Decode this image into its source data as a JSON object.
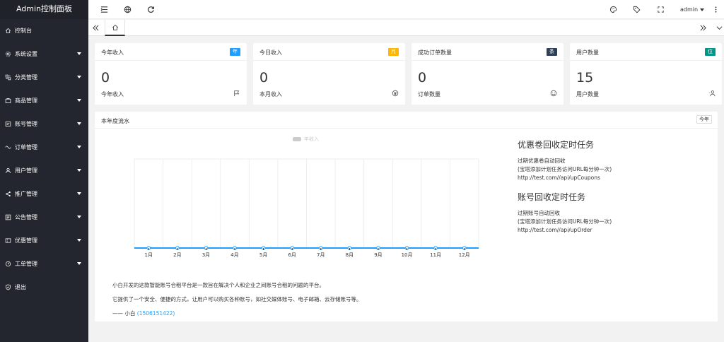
{
  "app": {
    "title": "Admin控制面板"
  },
  "sidebar": {
    "items": [
      {
        "label": "控制台",
        "icon": "home-icon",
        "arrow": false
      },
      {
        "label": "系统设置",
        "icon": "gear-icon",
        "arrow": true
      },
      {
        "label": "分类管理",
        "icon": "category-icon",
        "arrow": true
      },
      {
        "label": "商品管理",
        "icon": "product-icon",
        "arrow": true
      },
      {
        "label": "账号管理",
        "icon": "account-icon",
        "arrow": true
      },
      {
        "label": "订单管理",
        "icon": "order-icon",
        "arrow": true
      },
      {
        "label": "用户管理",
        "icon": "user-icon",
        "arrow": true
      },
      {
        "label": "推广管理",
        "icon": "share-icon",
        "arrow": true
      },
      {
        "label": "公告管理",
        "icon": "notice-icon",
        "arrow": true
      },
      {
        "label": "优惠管理",
        "icon": "coupon-icon",
        "arrow": true
      },
      {
        "label": "工单管理",
        "icon": "clock-icon",
        "arrow": true
      },
      {
        "label": "退出",
        "icon": "shield-icon",
        "arrow": false
      }
    ]
  },
  "topbar": {
    "user": "admin"
  },
  "cards": [
    {
      "title": "今年收入",
      "badge": "年",
      "badge_color": "#1e9fff",
      "value": "0",
      "sub": "今年收入",
      "icon": "flag-icon"
    },
    {
      "title": "今日收入",
      "badge": "月",
      "badge_color": "#ffb800",
      "value": "0",
      "sub": "本月收入",
      "icon": "money-icon"
    },
    {
      "title": "成功订单数量",
      "badge": "条",
      "badge_color": "#2f4056",
      "value": "0",
      "sub": "订单数量",
      "icon": "smile-icon"
    },
    {
      "title": "用户数量",
      "badge": "位",
      "badge_color": "#009688",
      "value": "15",
      "sub": "用户数量",
      "icon": "users-icon"
    }
  ],
  "panel": {
    "title": "本年度流水",
    "badge": "今年"
  },
  "chart_data": {
    "type": "line",
    "categories": [
      "1月",
      "2月",
      "3月",
      "4月",
      "5月",
      "6月",
      "7月",
      "8月",
      "9月",
      "10月",
      "11月",
      "12月"
    ],
    "series": [
      {
        "name": "年收入",
        "values": [
          0,
          0,
          0,
          0,
          0,
          0,
          0,
          0,
          0,
          0,
          0,
          0
        ]
      }
    ],
    "legend": "top-center",
    "grid": true,
    "line_color": "#1e9fff"
  },
  "tasks": [
    {
      "title": "优惠卷回收定时任务",
      "lines": [
        "过期优惠卷自动回收",
        "(宝塔添加计划任务访问URL每分钟一次)",
        "http://test.com//api/upCoupons"
      ]
    },
    {
      "title": "账号回收定时任务",
      "lines": [
        "过期账号自动回收",
        "(宝塔添加计划任务访问URL每分钟一次)",
        "http://test.com//api/upOrder"
      ]
    }
  ],
  "footer": {
    "line1": "小白开发的这款智能账号合租平台是一款旨在解决个人和企业之间账号合租的问题的平台。",
    "line2": "它提供了一个安全、便捷的方式，让用户可以购买各种账号，如社交媒体账号、电子邮箱、云存储账号等。",
    "author_prefix": "—— 小白",
    "contact": "(1506151422)"
  }
}
